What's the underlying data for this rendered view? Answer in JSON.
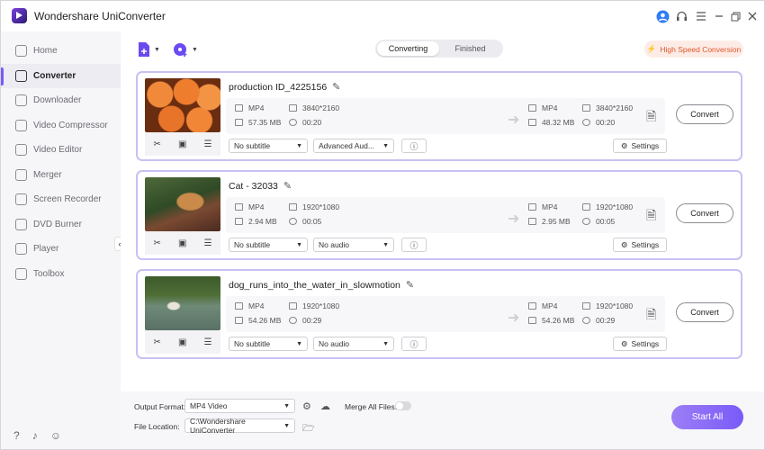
{
  "app": {
    "title": "Wondershare UniConverter"
  },
  "sidebar": {
    "items": [
      {
        "label": "Home"
      },
      {
        "label": "Converter"
      },
      {
        "label": "Downloader"
      },
      {
        "label": "Video Compressor"
      },
      {
        "label": "Video Editor"
      },
      {
        "label": "Merger"
      },
      {
        "label": "Screen Recorder"
      },
      {
        "label": "DVD Burner"
      },
      {
        "label": "Player"
      },
      {
        "label": "Toolbox"
      }
    ],
    "active_index": 1
  },
  "header": {
    "tabs": [
      {
        "label": "Converting"
      },
      {
        "label": "Finished"
      }
    ],
    "high_speed_label": "High Speed Conversion"
  },
  "files": [
    {
      "name": "production ID_4225156",
      "src_format": "MP4",
      "src_res": "3840*2160",
      "src_size": "57.35 MB",
      "src_dur": "00:20",
      "dst_format": "MP4",
      "dst_res": "3840*2160",
      "dst_size": "48.32 MB",
      "dst_dur": "00:20",
      "subtitle": "No subtitle",
      "audio": "Advanced Aud...",
      "settings_label": "Settings",
      "convert_label": "Convert"
    },
    {
      "name": "Cat - 32033",
      "src_format": "MP4",
      "src_res": "1920*1080",
      "src_size": "2.94 MB",
      "src_dur": "00:05",
      "dst_format": "MP4",
      "dst_res": "1920*1080",
      "dst_size": "2.95 MB",
      "dst_dur": "00:05",
      "subtitle": "No subtitle",
      "audio": "No audio",
      "settings_label": "Settings",
      "convert_label": "Convert"
    },
    {
      "name": "dog_runs_into_the_water_in_slowmotion",
      "src_format": "MP4",
      "src_res": "1920*1080",
      "src_size": "54.26 MB",
      "src_dur": "00:29",
      "dst_format": "MP4",
      "dst_res": "1920*1080",
      "dst_size": "54.26 MB",
      "dst_dur": "00:29",
      "subtitle": "No subtitle",
      "audio": "No audio",
      "settings_label": "Settings",
      "convert_label": "Convert"
    }
  ],
  "bottom": {
    "output_format_label": "Output Format:",
    "output_format_value": "MP4 Video",
    "merge_label": "Merge All Files:",
    "file_location_label": "File Location:",
    "file_location_value": "C:\\Wondershare UniConverter",
    "start_all_label": "Start All"
  },
  "colors": {
    "accent": "#7a5af8",
    "card_border": "#c9c0f2",
    "high_speed": "#e2572b"
  }
}
